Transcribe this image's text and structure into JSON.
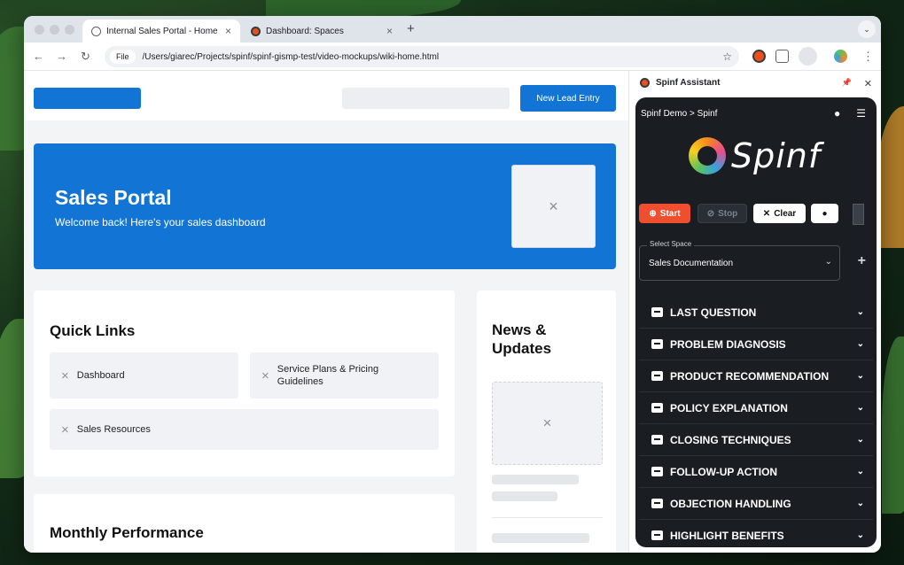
{
  "browser": {
    "tabs": [
      {
        "title": "Internal Sales Portal - Home",
        "close": "×"
      },
      {
        "title": "Dashboard: Spaces",
        "close": "×"
      }
    ],
    "new_tab": "+",
    "tab_menu": "⌄",
    "back": "←",
    "forward": "→",
    "reload": "↻",
    "url_chip": "File",
    "url": "/Users/giarec/Projects/spinf/spinf-gismp-test/video-mockups/wiki-home.html",
    "star": "☆"
  },
  "portal": {
    "new_lead_button": "New Lead Entry",
    "hero_title": "Sales Portal",
    "hero_subtitle": "Welcome back! Here's your sales dashboard",
    "placeholder_glyph": "×",
    "quick_links_title": "Quick Links",
    "quick_links": [
      "Dashboard",
      "Service Plans & Pricing Guidelines",
      "Sales Resources"
    ],
    "news_title": "News & Updates",
    "monthly_title": "Monthly Performance"
  },
  "assistant": {
    "panel_title": "Spinf Assistant",
    "pin_icon": "📌",
    "close_icon": "✕",
    "breadcrumb": "Spinf Demo > Spinf",
    "brand_name": "Spinf",
    "start_label": "Start",
    "stop_label": "Stop",
    "clear_label": "Clear",
    "select_label": "Select Space",
    "select_value": "Sales Documentation",
    "add": "+",
    "sections": [
      "LAST QUESTION",
      "PROBLEM DIAGNOSIS",
      "PRODUCT RECOMMENDATION",
      "POLICY EXPLANATION",
      "CLOSING TECHNIQUES",
      "FOLLOW-UP ACTION",
      "OBJECTION HANDLING",
      "HIGHLIGHT BENEFITS"
    ],
    "chevron": "⌄"
  },
  "colors": {
    "primary_blue": "#1275d6",
    "start_red": "#ef4e2f",
    "panel_dark": "#1a1d22"
  }
}
